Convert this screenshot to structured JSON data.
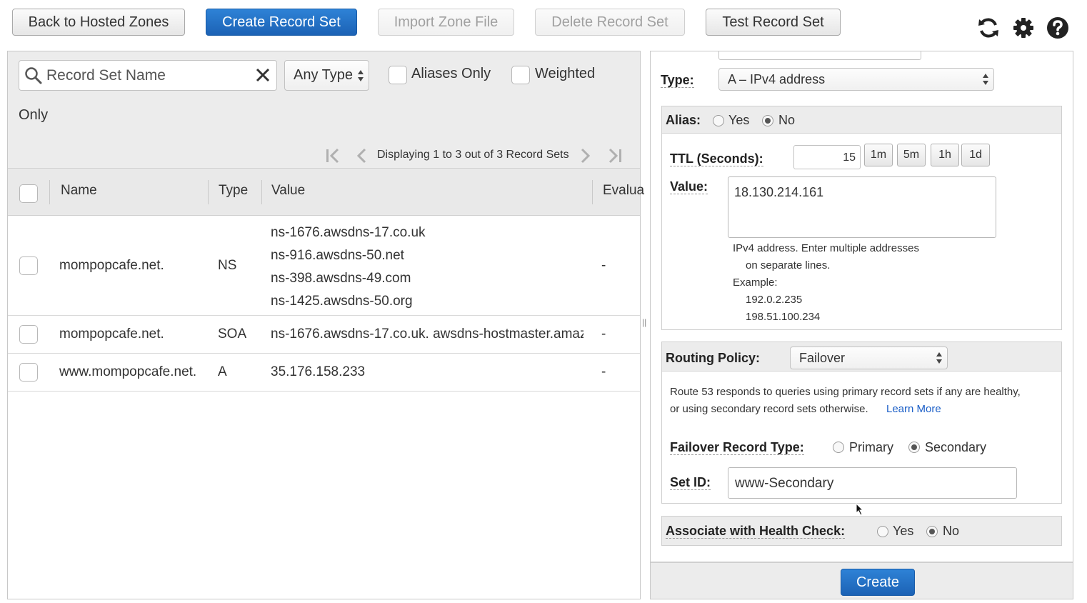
{
  "toolbar": {
    "back": "Back to Hosted Zones",
    "create": "Create Record Set",
    "import": "Import Zone File",
    "delete": "Delete Record Set",
    "test": "Test Record Set"
  },
  "filters": {
    "search_placeholder": "Record Set Name",
    "type_select": "Any Type",
    "aliases_only": "Aliases Only",
    "weighted": "Weighted",
    "weighted_wrap": "Only"
  },
  "pager": {
    "text": "Displaying 1 to 3 out of 3 Record Sets"
  },
  "table": {
    "headers": {
      "name": "Name",
      "type": "Type",
      "value": "Value",
      "evaluate": "Evalua"
    },
    "rows": [
      {
        "name": "mompopcafe.net.",
        "type": "NS",
        "values": [
          "ns-1676.awsdns-17.co.uk",
          "ns-916.awsdns-50.net",
          "ns-398.awsdns-49.com",
          "ns-1425.awsdns-50.org"
        ],
        "evaluate": "-"
      },
      {
        "name": "mompopcafe.net.",
        "type": "SOA",
        "values": [
          "ns-1676.awsdns-17.co.uk. awsdns-hostmaster.amaz"
        ],
        "evaluate": "-"
      },
      {
        "name": "www.mompopcafe.net.",
        "type": "A",
        "values": [
          "35.176.158.233"
        ],
        "evaluate": "-"
      }
    ]
  },
  "form": {
    "type_label": "Type:",
    "type_value": "A – IPv4 address",
    "alias_label": "Alias:",
    "alias_yes": "Yes",
    "alias_no": "No",
    "ttl_label": "TTL (Seconds):",
    "ttl_value": "15",
    "ttl_buttons": [
      "1m",
      "5m",
      "1h",
      "1d"
    ],
    "value_label": "Value:",
    "value_text": "18.130.214.161",
    "help": {
      "line1": "IPv4 address. Enter multiple addresses",
      "line2": "on separate lines.",
      "line3": "Example:",
      "line4": "192.0.2.235",
      "line5": "198.51.100.234"
    },
    "routing_label": "Routing Policy:",
    "routing_value": "Failover",
    "routing_desc1": "Route 53 responds to queries using primary record sets if any are healthy,",
    "routing_desc2": "or using secondary record sets otherwise.",
    "learn_more": "Learn More",
    "failover_label": "Failover Record Type:",
    "failover_primary": "Primary",
    "failover_secondary": "Secondary",
    "setid_label": "Set ID:",
    "setid_value": "www-Secondary",
    "health_label": "Associate with Health Check:",
    "health_yes": "Yes",
    "health_no": "No",
    "create_button": "Create"
  }
}
